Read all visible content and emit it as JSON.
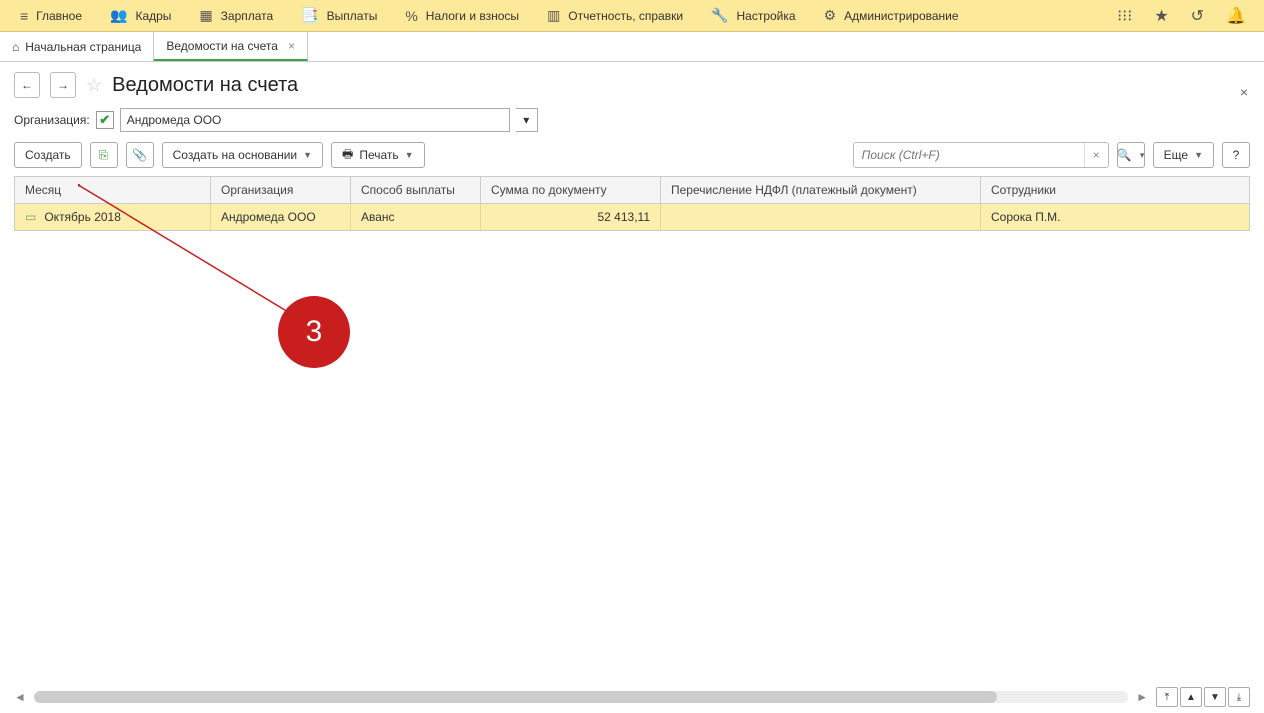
{
  "menu": {
    "items": [
      {
        "icon": "≡",
        "label": "Главное"
      },
      {
        "icon": "👥",
        "label": "Кадры"
      },
      {
        "icon": "▦",
        "label": "Зарплата"
      },
      {
        "icon": "📑",
        "label": "Выплаты"
      },
      {
        "icon": "%",
        "label": "Налоги и взносы"
      },
      {
        "icon": "▥",
        "label": "Отчетность, справки"
      },
      {
        "icon": "🔧",
        "label": "Настройка"
      },
      {
        "icon": "⚙",
        "label": "Администрирование"
      }
    ]
  },
  "tabs": {
    "home": "Начальная страница",
    "active": "Ведомости на счета"
  },
  "page": {
    "title": "Ведомости на счета"
  },
  "filter": {
    "label": "Организация:",
    "checked": "✔",
    "org_value": "Андромеда ООО"
  },
  "toolbar": {
    "create": "Создать",
    "create_based": "Создать на основании",
    "print": "Печать",
    "more": "Еще",
    "help": "?",
    "search_placeholder": "Поиск (Ctrl+F)"
  },
  "table": {
    "headers": {
      "month": "Месяц",
      "org": "Организация",
      "method": "Способ выплаты",
      "sum": "Сумма по документу",
      "ndfl": "Перечисление НДФЛ (платежный документ)",
      "emp": "Сотрудники"
    },
    "rows": [
      {
        "month": "Октябрь 2018",
        "org": "Андромеда ООО",
        "method": "Аванс",
        "sum": "52 413,11",
        "ndfl": "",
        "emp": "Сорока П.М."
      }
    ]
  },
  "annotation": {
    "badge": "3"
  }
}
